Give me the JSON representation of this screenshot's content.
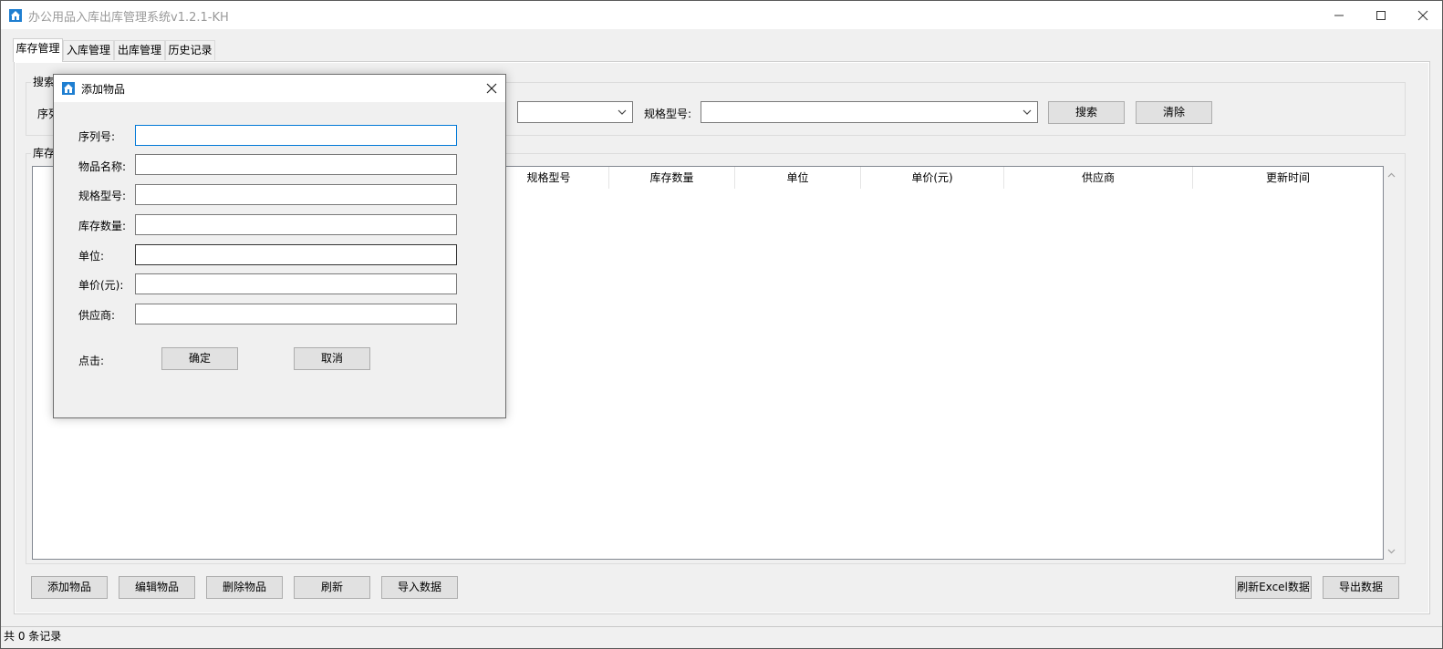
{
  "window": {
    "title": "办公用品入库出库管理系统v1.2.1-KH"
  },
  "tabs": [
    "库存管理",
    "入库管理",
    "出库管理",
    "历史记录"
  ],
  "search": {
    "group_label": "搜索",
    "serial_label": "序列",
    "spec_label": "规格型号:",
    "search_button": "搜索",
    "clear_button": "清除"
  },
  "inventory": {
    "group_label": "库存",
    "columns": [
      "规格型号",
      "库存数量",
      "单位",
      "单价(元)",
      "供应商",
      "更新时间"
    ]
  },
  "actions": {
    "add": "添加物品",
    "edit": "编辑物品",
    "delete": "删除物品",
    "refresh": "刷新",
    "import": "导入数据",
    "refresh_excel": "刷新Excel数据",
    "export": "导出数据"
  },
  "status": {
    "text": "共 0 条记录"
  },
  "dialog": {
    "title": "添加物品",
    "fields": [
      {
        "label": "序列号:",
        "value": ""
      },
      {
        "label": "物品名称:",
        "value": ""
      },
      {
        "label": "规格型号:",
        "value": ""
      },
      {
        "label": "库存数量:",
        "value": ""
      },
      {
        "label": "单位:",
        "value": ""
      },
      {
        "label": "单价(元):",
        "value": ""
      },
      {
        "label": "供应商:",
        "value": ""
      }
    ],
    "click_label": "点击:",
    "ok_button": "确定",
    "cancel_button": "取消"
  },
  "colors": {
    "accent": "#0078d7",
    "window_bg": "#f0f0f0",
    "button_bg": "#e1e1e1",
    "icon_blue": "#1f7fd1"
  },
  "icons": {
    "app": "house-app-icon",
    "minimize": "minimize-icon",
    "maximize": "maximize-icon",
    "close": "close-icon",
    "dropdown": "chevron-down-icon"
  }
}
